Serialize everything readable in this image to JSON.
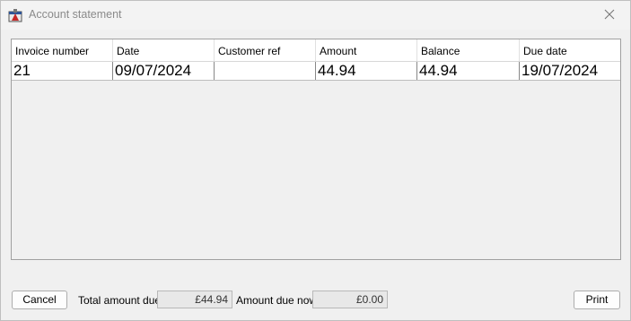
{
  "window": {
    "title": "Account statement"
  },
  "table": {
    "columns": [
      "Invoice number",
      "Date",
      "Customer ref",
      "Amount",
      "Balance",
      "Due date"
    ],
    "rows": [
      [
        "21",
        "09/07/2024",
        "",
        "44.94",
        "44.94",
        "19/07/2024"
      ]
    ]
  },
  "footer": {
    "cancel_label": "Cancel",
    "total_label": "Total amount due",
    "total_value": "£44.94",
    "due_now_label": "Amount due now",
    "due_now_value": "£0.00",
    "print_label": "Print"
  },
  "icons": {
    "app": "app-icon",
    "close": "close-icon"
  }
}
